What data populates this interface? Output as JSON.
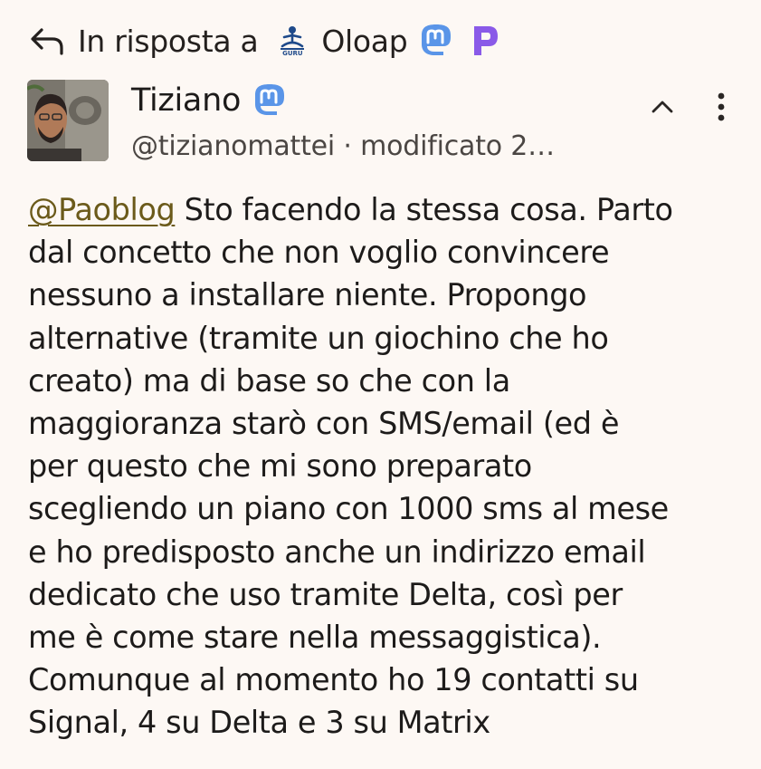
{
  "reply": {
    "label": "In risposta a",
    "name": "Oloap",
    "reply_icon": "reply-arrow-icon",
    "avatar_logo_text": "GURU",
    "badges": [
      "mastodon-icon",
      "pixelfed-icon"
    ]
  },
  "author": {
    "name": "Tiziano",
    "badge": "mastodon-icon",
    "meta": "@tizianomattei · modificato 2…"
  },
  "actions": {
    "collapse_icon": "chevron-up-icon",
    "menu_icon": "more-vert-icon"
  },
  "post": {
    "mention": "@Paoblog",
    "lines": [
      " Sto facendo la stessa cosa. Parto",
      "dal concetto che non voglio convincere",
      "nessuno a installare niente. Propongo",
      "alternative (tramite un giochino che ho",
      "creato) ma di base so che con la",
      "maggioranza starò con SMS/email (ed è",
      "per questo che mi sono preparato",
      "scegliendo un piano con 1000 sms al mese",
      "e ho predisposto anche un indirizzo email",
      "dedicato che uso tramite Delta, così per",
      "me è come stare nella messaggistica).",
      "Comunque al momento ho 19 contatti su",
      "Signal, 4 su Delta e 3 su Matrix"
    ]
  },
  "colors": {
    "background": "#fdf8f4",
    "text": "#1d1b1a",
    "mention": "#6b5a1a",
    "mastodon": "#5a95e8",
    "pixelfed": "#8a5ae8"
  }
}
